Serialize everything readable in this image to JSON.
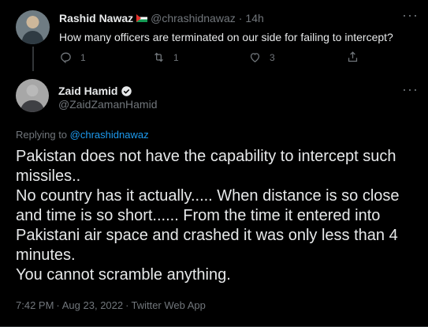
{
  "reply_tweet": {
    "display_name": "Rashid Nawaz",
    "handle": "@chrashidnawaz",
    "time_dot": "·",
    "time": "14h",
    "text": "How many officers are terminated on our side for failing to intercept?",
    "actions": {
      "reply_count": "1",
      "retweet_count": "1",
      "like_count": "3"
    }
  },
  "main_tweet": {
    "display_name": "Zaid Hamid",
    "handle": "@ZaidZamanHamid",
    "replying_prefix": "Replying to ",
    "replying_handle": "@chrashidnawaz",
    "text": "Pakistan does not have the capability to intercept such missiles..\nNo country has it actually..... When distance is so close and time is so short...... From the time it entered into Pakistani air space and crashed it was only less than  4 minutes.\nYou cannot scramble anything.",
    "timestamp": "7:42 PM",
    "date": "Aug 23, 2022",
    "source": "Twitter Web App",
    "separator": "·"
  },
  "icons": {
    "reply": "reply-icon",
    "retweet": "retweet-icon",
    "like": "heart-icon",
    "share": "share-icon",
    "more": "more-horizontal-icon",
    "verified": "verified-badge-icon",
    "flag": "palestine-flag-icon"
  },
  "colors": {
    "background": "#000000",
    "text_primary": "#e7e9ea",
    "text_secondary": "#71767b",
    "accent": "#1d9bf0",
    "divider": "#2f3336"
  }
}
